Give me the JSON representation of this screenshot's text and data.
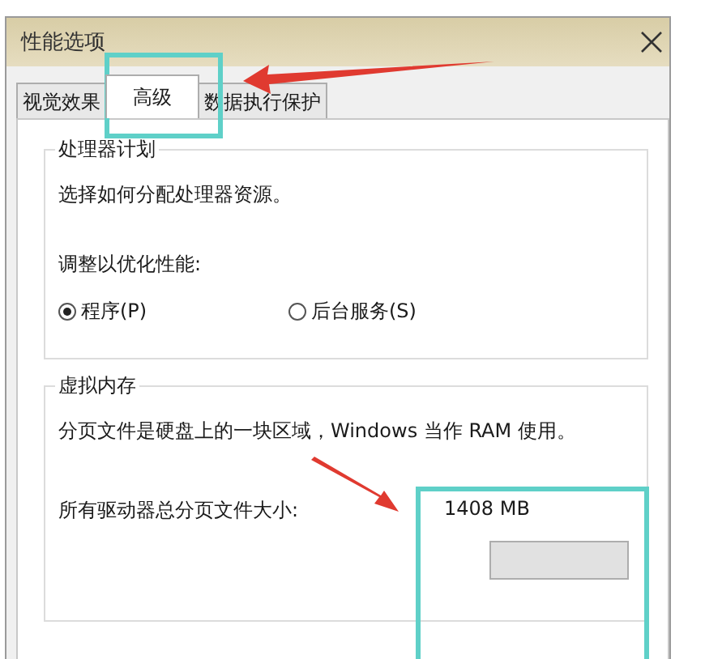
{
  "window": {
    "title": "性能选项"
  },
  "tabs": [
    {
      "label": "视觉效果",
      "selected": false
    },
    {
      "label": "高级",
      "selected": true
    },
    {
      "label": "数据执行保护",
      "selected": false
    }
  ],
  "processor_group": {
    "title": "处理器计划",
    "description": "选择如何分配处理器资源。",
    "prompt": "调整以优化性能:",
    "options": [
      {
        "label": "程序(P)",
        "selected": true
      },
      {
        "label": "后台服务(S)",
        "selected": false
      }
    ]
  },
  "virtual_memory_group": {
    "title": "虚拟内存",
    "description": "分页文件是硬盘上的一块区域，Windows 当作 RAM 使用。",
    "size_label": "所有驱动器总分页文件大小:",
    "size_value": "1408 MB"
  }
}
